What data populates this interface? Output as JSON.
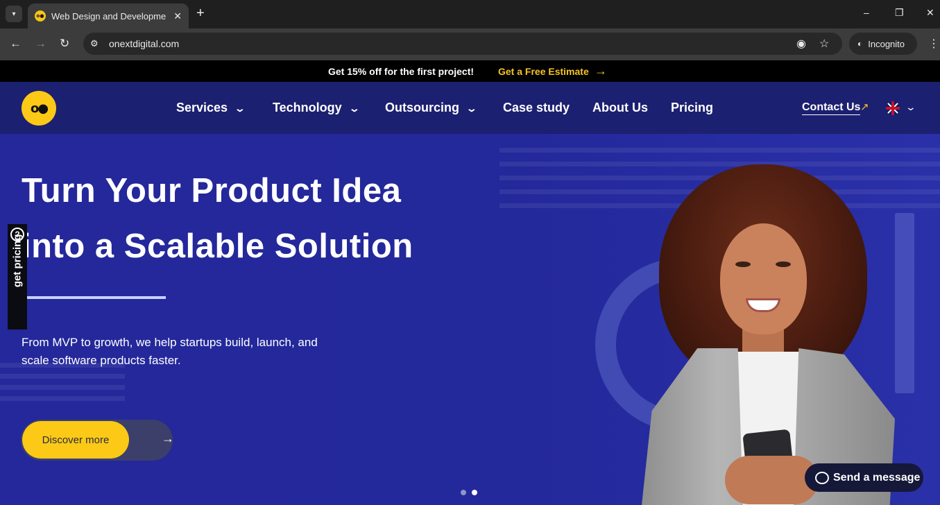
{
  "browser": {
    "tab_title": "Web Design and Development",
    "url": "onextdigital.com",
    "incognito_label": "Incognito",
    "window_controls": {
      "minimize": "–",
      "restore": "❐",
      "close": "✕"
    }
  },
  "promo": {
    "text": "Get 15% off for the first project!",
    "link": "Get a Free Estimate",
    "arrow": "→"
  },
  "logo": {
    "mark": "o●"
  },
  "nav": {
    "items": [
      {
        "label": "Services",
        "has_dropdown": true
      },
      {
        "label": "Technology",
        "has_dropdown": true
      },
      {
        "label": "Outsourcing",
        "has_dropdown": true
      },
      {
        "label": "Case study",
        "has_dropdown": false
      },
      {
        "label": "About Us",
        "has_dropdown": false
      },
      {
        "label": "Pricing",
        "has_dropdown": false
      }
    ],
    "contact_label": "Contact Us",
    "contact_arrow": "↗",
    "language": "EN"
  },
  "hero": {
    "title_line1": "Turn Your Product Idea",
    "title_line2": "into a Scalable Solution",
    "subtitle": "From MVP to growth, we help startups build, launch, and scale software products faster.",
    "cta_label": "Discover more",
    "cta_arrow": "→"
  },
  "side_tab": {
    "label": "get pricing",
    "icon": "?"
  },
  "carousel": {
    "slides": 2,
    "active_slide": 2
  },
  "chat": {
    "label": "Send a message"
  },
  "colors": {
    "accent": "#fcc917",
    "hero_bg": "#24289b",
    "header_bg": "#1c2070"
  }
}
